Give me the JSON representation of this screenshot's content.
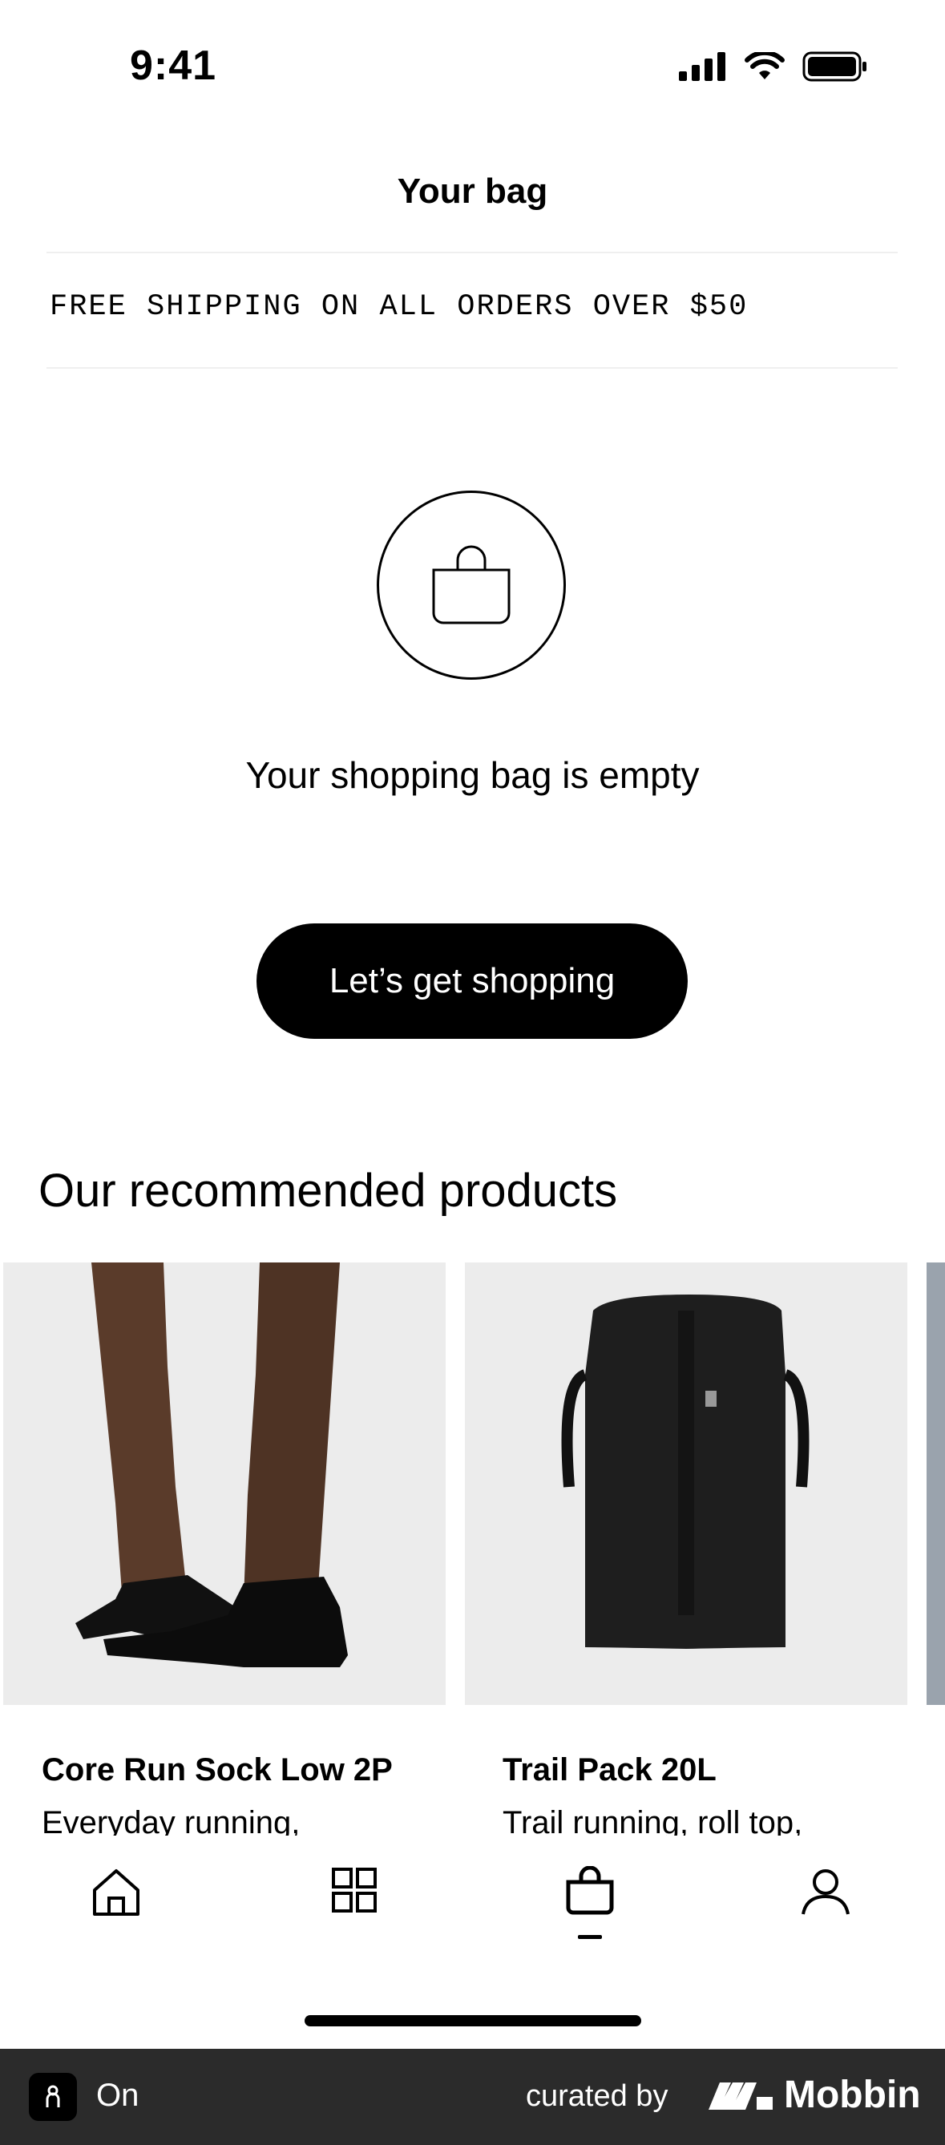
{
  "status_bar": {
    "time": "9:41"
  },
  "header": {
    "title": "Your bag",
    "promo": "FREE SHIPPING ON ALL ORDERS OVER $50"
  },
  "empty_state": {
    "message": "Your shopping bag is empty",
    "cta_label": "Let’s get shopping"
  },
  "recommended": {
    "title": "Our recommended products",
    "products": [
      {
        "name": "Core Run Sock Low 2P",
        "description": "Everyday running,"
      },
      {
        "name": "Trail Pack 20L",
        "description": "Trail running, roll top,"
      }
    ]
  },
  "tabs": [
    {
      "icon": "home-icon"
    },
    {
      "icon": "grid-icon"
    },
    {
      "icon": "bag-icon",
      "active": true
    },
    {
      "icon": "profile-icon"
    }
  ],
  "footer": {
    "app_name": "On",
    "curated_label": "curated by",
    "brand": "Mobbin"
  }
}
